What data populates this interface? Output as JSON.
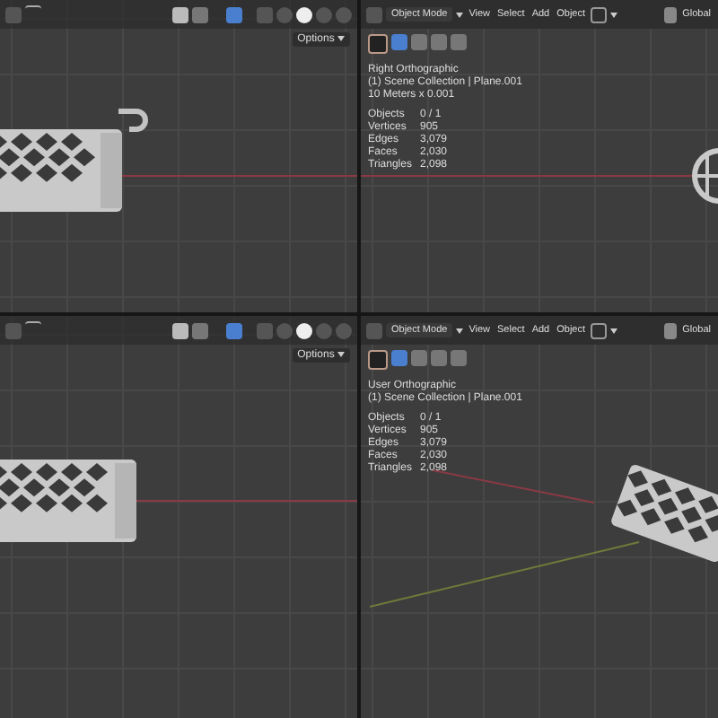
{
  "viewports": [
    {
      "kind": "side-hook",
      "options": "Options"
    },
    {
      "kind": "end-wheel",
      "mode": "Object Mode",
      "menus": [
        "View",
        "Select",
        "Add",
        "Object"
      ],
      "orientation": "Global",
      "view_name": "Right Orthographic",
      "collection": "(1) Scene Collection | Plane.001",
      "scale": "10 Meters x 0.001",
      "stats": [
        {
          "label": "Objects",
          "value": "0 / 1"
        },
        {
          "label": "Vertices",
          "value": "905"
        },
        {
          "label": "Edges",
          "value": "3,079"
        },
        {
          "label": "Faces",
          "value": "2,030"
        },
        {
          "label": "Triangles",
          "value": "2,098"
        }
      ]
    },
    {
      "kind": "side-plain",
      "options": "Options"
    },
    {
      "kind": "perspective",
      "mode": "Object Mode",
      "menus": [
        "View",
        "Select",
        "Add",
        "Object"
      ],
      "orientation": "Global",
      "view_name": "User Orthographic",
      "collection": "(1) Scene Collection | Plane.001",
      "stats": [
        {
          "label": "Objects",
          "value": "0 / 1"
        },
        {
          "label": "Vertices",
          "value": "905"
        },
        {
          "label": "Edges",
          "value": "3,079"
        },
        {
          "label": "Faces",
          "value": "2,030"
        },
        {
          "label": "Triangles",
          "value": "2,098"
        }
      ]
    }
  ]
}
